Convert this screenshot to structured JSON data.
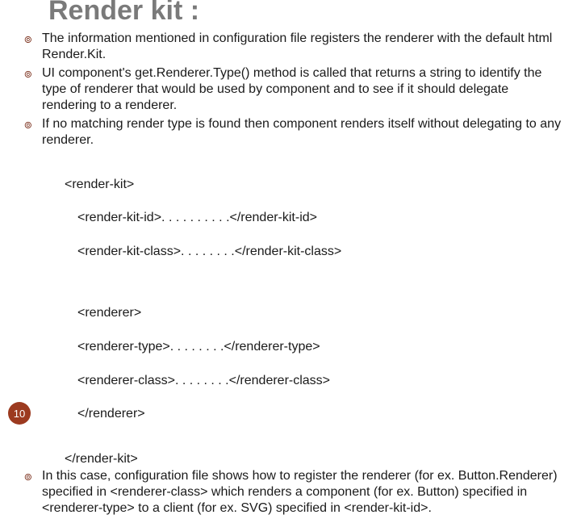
{
  "title": "Render kit :",
  "bullets": [
    "The information mentioned in configuration file registers the renderer with the default html Render.Kit.",
    "UI component's get.Renderer.Type() method is called that returns a string to identify the type of renderer that would be used by component and to see if it should delegate rendering to a renderer.",
    "If no matching render type is found then component renders itself without delegating to any renderer."
  ],
  "code1_line1": "<render-kit>",
  "code1_line2": "<render-kit-id>. . . . . . . . . .</render-kit-id>",
  "code1_line3": "<render-kit-class>. . . . . . . .</render-kit-class>",
  "code2_line1": "<renderer>",
  "code2_line2": "<renderer-type>. . . . . . . .</renderer-type>",
  "code2_line3": "<renderer-class>. . . . . . . .</renderer-class>",
  "code2_line4": "</renderer>",
  "code_close": "</render-kit>",
  "bullet_last": "In this case, configuration file shows how to register the renderer (for ex. Button.Renderer) specified in <renderer-class> which renders a component (for ex. Button) specified in <renderer-type> to a client (for ex. SVG) specified in <render-kit-id>.",
  "page_number": "10",
  "bullet_glyph": "๏"
}
